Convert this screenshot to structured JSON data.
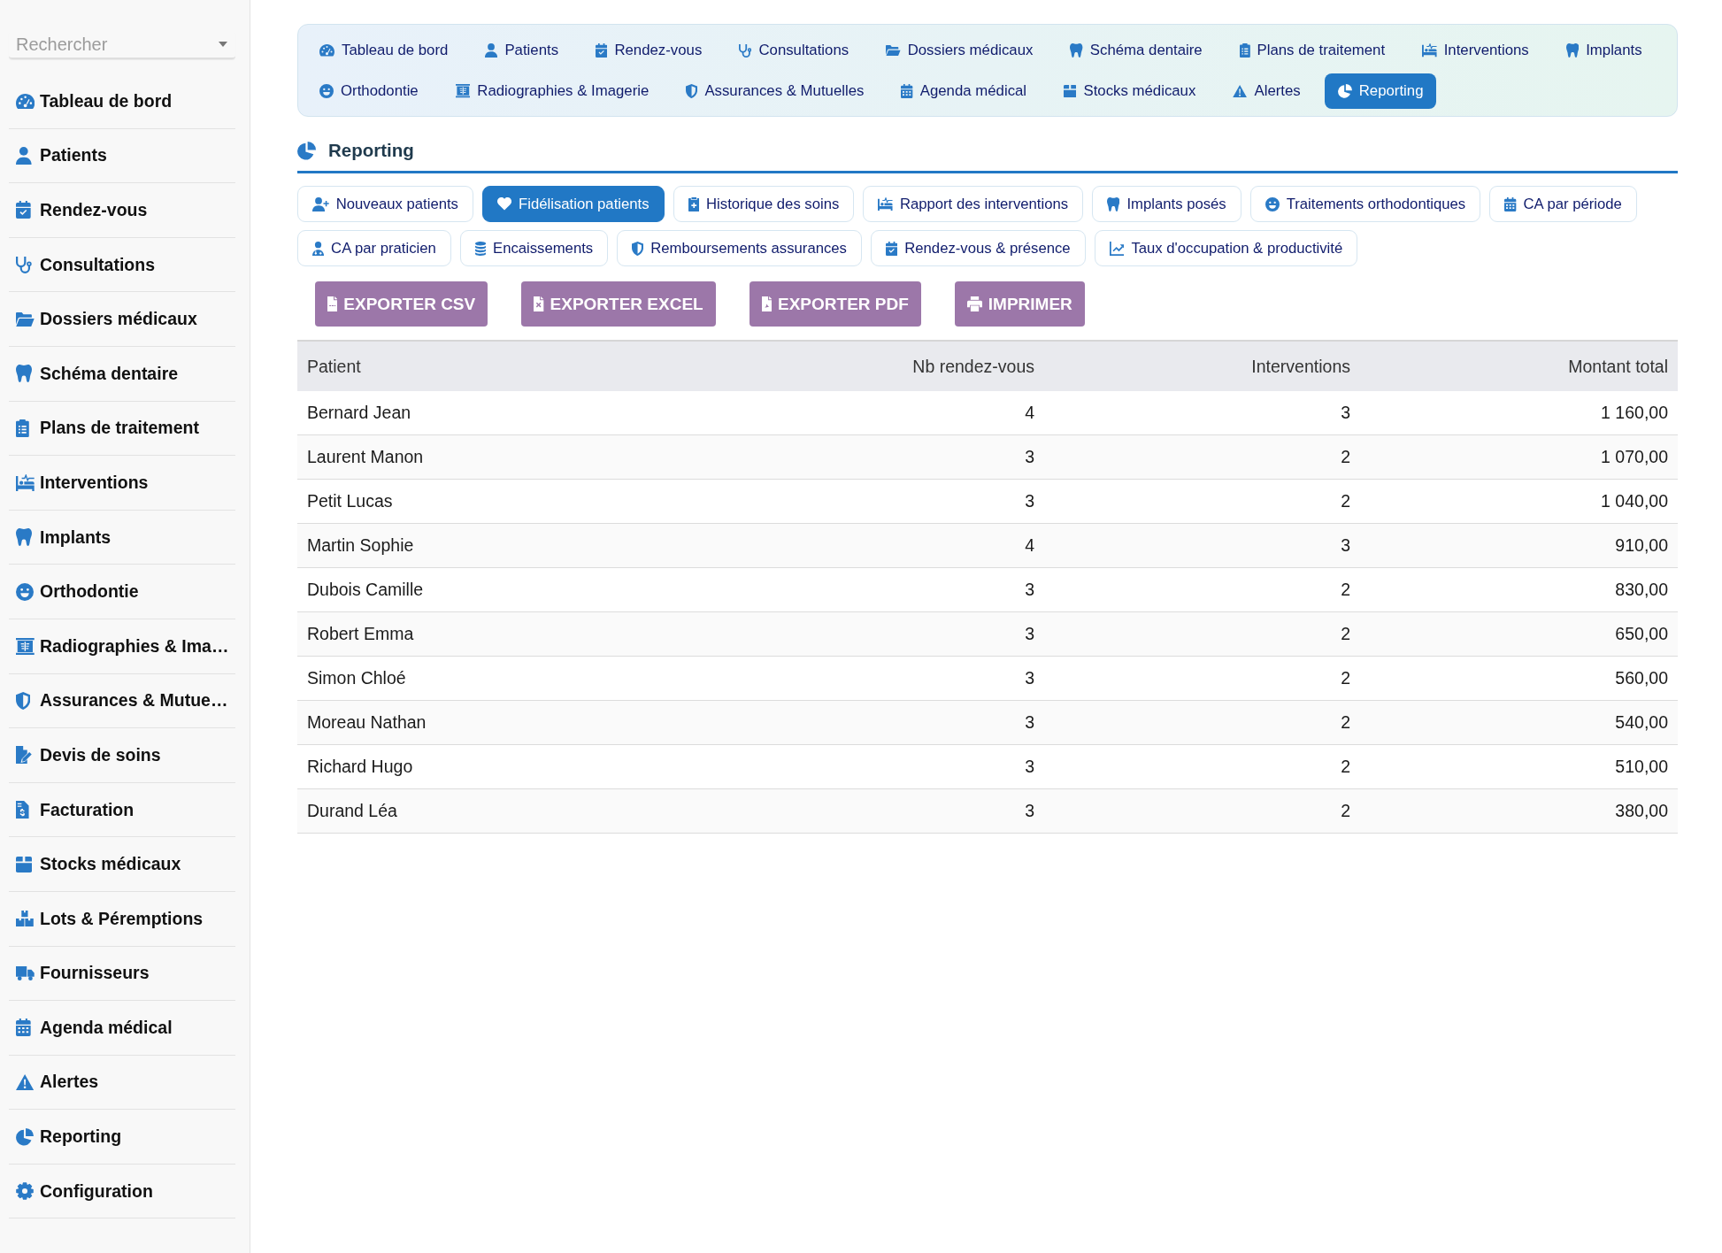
{
  "sidebar": {
    "search": {
      "placeholder": "Rechercher"
    },
    "items": [
      "Tableau de bord",
      "Patients",
      "Rendez-vous",
      "Consultations",
      "Dossiers médicaux",
      "Schéma dentaire",
      "Plans de traitement",
      "Interventions",
      "Implants",
      "Orthodontie",
      "Radiographies & Ima…",
      "Assurances & Mutue…",
      "Devis de soins",
      "Facturation",
      "Stocks médicaux",
      "Lots & Péremptions",
      "Fournisseurs",
      "Agenda médical",
      "Alertes",
      "Reporting",
      "Configuration"
    ]
  },
  "top_nav": {
    "items": [
      {
        "label": "Tableau de bord",
        "selected": false
      },
      {
        "label": "Patients",
        "selected": false
      },
      {
        "label": "Rendez-vous",
        "selected": false
      },
      {
        "label": "Consultations",
        "selected": false
      },
      {
        "label": "Dossiers médicaux",
        "selected": false
      },
      {
        "label": "Schéma dentaire",
        "selected": false
      },
      {
        "label": "Plans de traitement",
        "selected": false
      },
      {
        "label": "Interventions",
        "selected": false
      },
      {
        "label": "Implants",
        "selected": false
      },
      {
        "label": "Orthodontie",
        "selected": false
      },
      {
        "label": "Radiographies & Imagerie",
        "selected": false
      },
      {
        "label": "Assurances & Mutuelles",
        "selected": false
      },
      {
        "label": "Agenda médical",
        "selected": false
      },
      {
        "label": "Stocks médicaux",
        "selected": false
      },
      {
        "label": "Alertes",
        "selected": false
      },
      {
        "label": "Reporting",
        "selected": true
      }
    ]
  },
  "section": {
    "title": "Reporting"
  },
  "report_tabs": [
    {
      "label": "Nouveaux patients",
      "selected": false
    },
    {
      "label": "Fidélisation patients",
      "selected": true
    },
    {
      "label": "Historique des soins",
      "selected": false
    },
    {
      "label": "Rapport des interventions",
      "selected": false
    },
    {
      "label": "Implants posés",
      "selected": false
    },
    {
      "label": "Traitements orthodontiques",
      "selected": false
    },
    {
      "label": "CA par période",
      "selected": false
    },
    {
      "label": "CA par praticien",
      "selected": false
    },
    {
      "label": "Encaissements",
      "selected": false
    },
    {
      "label": "Remboursements assurances",
      "selected": false
    },
    {
      "label": "Rendez-vous & présence",
      "selected": false
    },
    {
      "label": "Taux d'occupation & productivité",
      "selected": false
    }
  ],
  "export_buttons": [
    "EXPORTER CSV",
    "EXPORTER EXCEL",
    "EXPORTER PDF",
    "IMPRIMER"
  ],
  "table": {
    "columns": [
      "Patient",
      "Nb rendez-vous",
      "Interventions",
      "Montant total"
    ],
    "rows": [
      [
        "Bernard Jean",
        "4",
        "3",
        "1 160,00"
      ],
      [
        "Laurent Manon",
        "3",
        "2",
        "1 070,00"
      ],
      [
        "Petit Lucas",
        "3",
        "2",
        "1 040,00"
      ],
      [
        "Martin Sophie",
        "4",
        "3",
        "910,00"
      ],
      [
        "Dubois Camille",
        "3",
        "2",
        "830,00"
      ],
      [
        "Robert Emma",
        "3",
        "2",
        "650,00"
      ],
      [
        "Simon Chloé",
        "3",
        "2",
        "560,00"
      ],
      [
        "Moreau Nathan",
        "3",
        "2",
        "540,00"
      ],
      [
        "Richard Hugo",
        "3",
        "2",
        "510,00"
      ],
      [
        "Durand Léa",
        "3",
        "2",
        "380,00"
      ]
    ]
  }
}
